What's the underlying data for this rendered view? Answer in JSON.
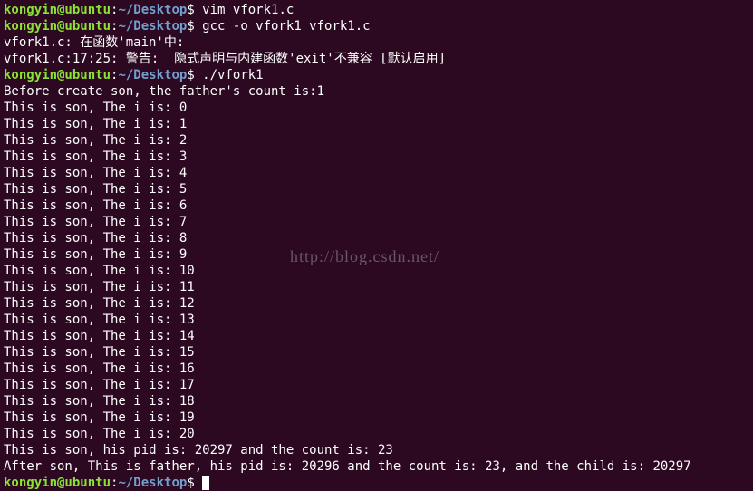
{
  "prompt": {
    "user": "kongyin@ubuntu",
    "sep": ":",
    "path": "~/Desktop",
    "sigil": "$ "
  },
  "commands": {
    "vim": "vim vfork1.c",
    "gcc": "gcc -o vfork1 vfork1.c",
    "run": "./vfork1"
  },
  "gcc_output": {
    "line1": "vfork1.c: 在函数'main'中:",
    "line2": "vfork1.c:17:25: 警告:  隐式声明与内建函数'exit'不兼容 [默认启用]"
  },
  "program_output": {
    "before": "Before create son, the father's count is:1",
    "loop": [
      "This is son, The i is: 0",
      "This is son, The i is: 1",
      "This is son, The i is: 2",
      "This is son, The i is: 3",
      "This is son, The i is: 4",
      "This is son, The i is: 5",
      "This is son, The i is: 6",
      "This is son, The i is: 7",
      "This is son, The i is: 8",
      "This is son, The i is: 9",
      "This is son, The i is: 10",
      "This is son, The i is: 11",
      "This is son, The i is: 12",
      "This is son, The i is: 13",
      "This is son, The i is: 14",
      "This is son, The i is: 15",
      "This is son, The i is: 16",
      "This is son, The i is: 17",
      "This is son, The i is: 18",
      "This is son, The i is: 19",
      "This is son, The i is: 20"
    ],
    "son_summary": "This is son, his pid is: 20297 and the count is: 23",
    "father_summary": "After son, This is father, his pid is: 20296 and the count is: 23, and the child is: 20297"
  },
  "watermark": "http://blog.csdn.net/"
}
